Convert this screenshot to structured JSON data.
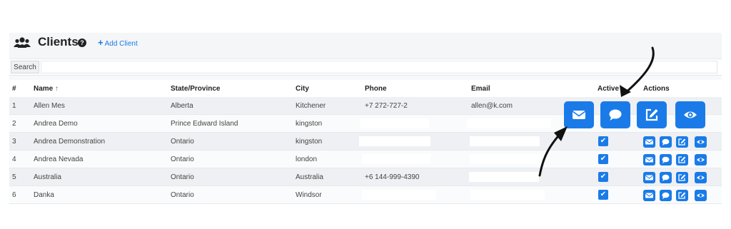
{
  "header": {
    "title": "Clients",
    "help_glyph": "?",
    "add_label": "Add Client",
    "add_glyph": "+"
  },
  "search": {
    "button_label": "Search",
    "placeholder": "",
    "value": ""
  },
  "table": {
    "columns": {
      "num": "#",
      "name": "Name",
      "sort_glyph": "↑",
      "state": "State/Province",
      "city": "City",
      "phone": "Phone",
      "email": "Email",
      "active": "Active",
      "actions": "Actions"
    },
    "rows": [
      {
        "num": "1",
        "name": "Allen Mes",
        "state": "Alberta",
        "city": "Kitchener",
        "phone": "+7 272-727-2",
        "email": "allen@k.com",
        "active": null
      },
      {
        "num": "2",
        "name": "Andrea Demo",
        "state": "Prince Edward Island",
        "city": "kingston",
        "phone": "",
        "email": "",
        "active": null
      },
      {
        "num": "3",
        "name": "Andrea Demonstration",
        "state": "Ontario",
        "city": "kingston",
        "phone": "",
        "email": "",
        "active": true
      },
      {
        "num": "4",
        "name": "Andrea Nevada",
        "state": "Ontario",
        "city": "london",
        "phone": "",
        "email": "",
        "active": true
      },
      {
        "num": "5",
        "name": "Australia",
        "state": "Ontario",
        "city": "Australia",
        "phone": "+6 144-999-4390",
        "email": "",
        "active": true
      },
      {
        "num": "6",
        "name": "Danka",
        "state": "Ontario",
        "city": "Windsor",
        "phone": "",
        "email": "",
        "active": true
      }
    ],
    "check_glyph": "✔"
  },
  "colors": {
    "accent": "#1a7be8",
    "row_odd": "#eef0f3",
    "row_even": "#fafbfc",
    "arrow": "#111111"
  },
  "icons": [
    "users-icon",
    "help-icon",
    "plus-icon",
    "envelope-icon",
    "comment-icon",
    "edit-icon",
    "eye-icon",
    "check-icon",
    "arrow-icon"
  ]
}
